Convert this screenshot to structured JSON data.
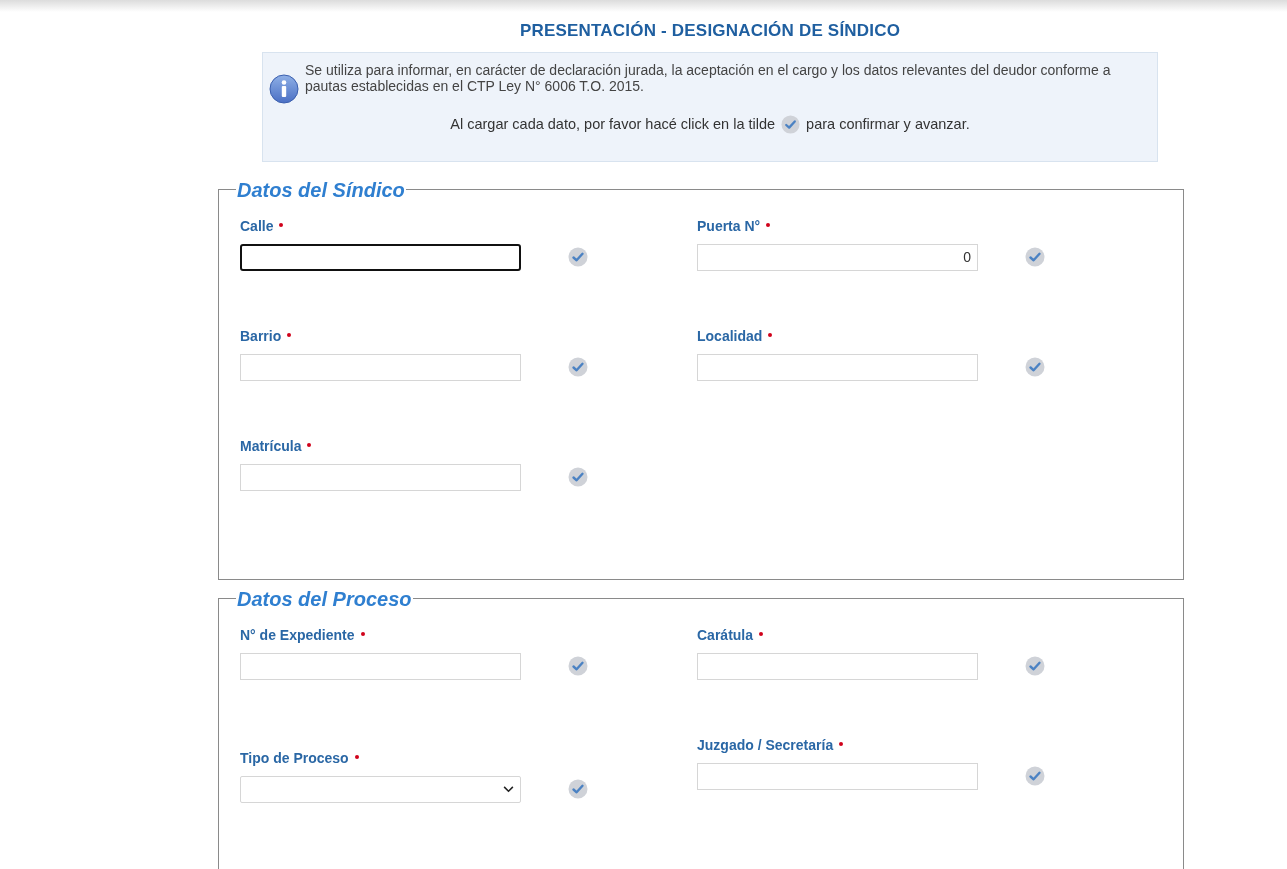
{
  "page_title": "PRESENTACIÓN - DESIGNACIÓN DE SÍNDICO",
  "info": {
    "text": "Se utiliza para informar, en carácter de declaración jurada, la aceptación en el cargo y los datos relevantes del deudor conforme a pautas establecidas en el CTP Ley N° 6006 T.O. 2015.",
    "hint_before": "Al cargar cada dato, por favor hacé click en la tilde",
    "hint_after": "para confirmar y avanzar."
  },
  "sections": [
    {
      "legend": "Datos del Síndico",
      "rows": [
        [
          {
            "label": "Calle",
            "required": true,
            "kind": "text",
            "focused": true
          },
          {
            "label": "Puerta N°",
            "required": true,
            "kind": "number",
            "value": "0",
            "focused": false
          }
        ],
        [
          {
            "label": "Barrio",
            "required": true,
            "kind": "text",
            "focused": false
          },
          {
            "label": "Localidad",
            "required": true,
            "kind": "text",
            "focused": false
          }
        ],
        [
          {
            "label": "Matrícula",
            "required": true,
            "kind": "text",
            "focused": false
          }
        ]
      ]
    },
    {
      "legend": "Datos del Proceso",
      "rows": [
        [
          {
            "label": "N° de Expediente",
            "required": true,
            "kind": "text",
            "focused": false
          },
          {
            "label": "Carátula",
            "required": true,
            "kind": "text",
            "focused": false
          }
        ],
        [
          {
            "label": "Tipo de Proceso",
            "required": true,
            "kind": "select",
            "focused": false
          },
          {
            "label": "Juzgado / Secretaría",
            "required": true,
            "kind": "text",
            "focused": false
          }
        ]
      ]
    }
  ]
}
